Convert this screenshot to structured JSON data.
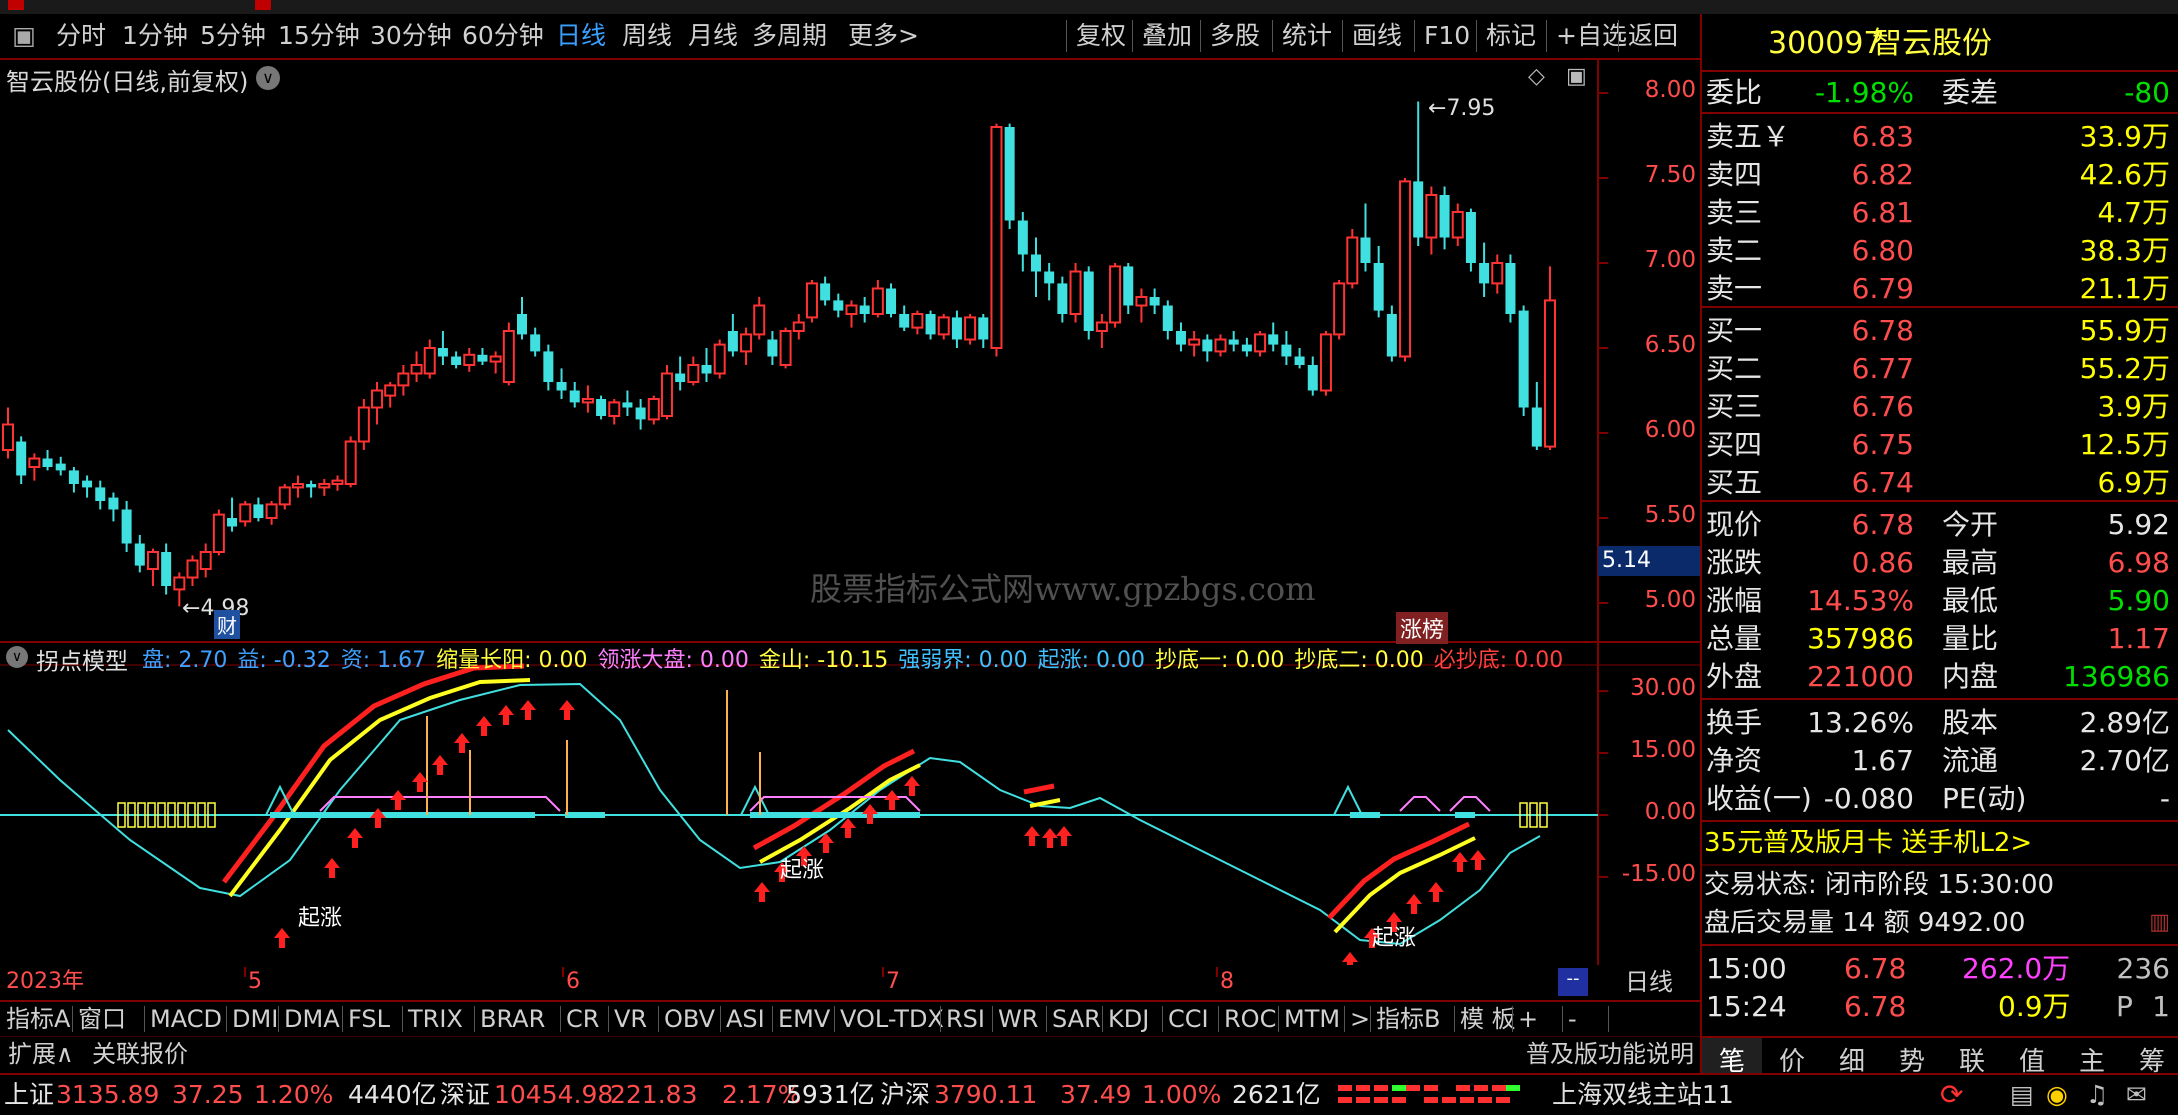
{
  "toolbar": {
    "items": [
      "分时",
      "1分钟",
      "5分钟",
      "15分钟",
      "30分钟",
      "60分钟",
      "日线",
      "周线",
      "月线",
      "多周期",
      "更多>"
    ],
    "active": "日线",
    "right_items": [
      "复权",
      "叠加",
      "多股",
      "统计",
      "画线",
      "F10",
      "标记",
      "+自选",
      "返回"
    ]
  },
  "chart": {
    "title": "智云股份(日线,前复权)",
    "price_axis": [
      "8.00",
      "7.50",
      "7.00",
      "6.50",
      "6.00",
      "5.50",
      "5.00"
    ],
    "price_marker": "5.14",
    "high_label": "7.95",
    "low_label": "4.98",
    "tag_cai": "财",
    "tag_zhangbang": "涨榜",
    "watermark": "股票指标公式网www.gpzbgs.com"
  },
  "indicator": {
    "name": "拐点模型",
    "params": [
      {
        "label": "盘: 2.70",
        "color": "#40a0ff"
      },
      {
        "label": "益: -0.32",
        "color": "#40a0ff"
      },
      {
        "label": "资: 1.67",
        "color": "#40a0ff"
      },
      {
        "label": "缩量长阳: 0.00",
        "color": "#ffff40"
      },
      {
        "label": "领涨大盘: 0.00",
        "color": "#ff80ff"
      },
      {
        "label": "金山: -10.15",
        "color": "#ffff40"
      },
      {
        "label": "强弱界: 0.00",
        "color": "#40c0ff"
      },
      {
        "label": "起涨: 0.00",
        "color": "#40c0ff"
      },
      {
        "label": "抄底一: 0.00",
        "color": "#ffff40"
      },
      {
        "label": "抄底二: 0.00",
        "color": "#ffff40"
      },
      {
        "label": "必抄底: 0.00",
        "color": "#ff4040"
      }
    ],
    "axis": [
      "30.00",
      "15.00",
      "0.00",
      "-15.00"
    ],
    "qizhang": "起涨"
  },
  "date_axis": {
    "labels": [
      "2023年",
      "5",
      "6",
      "7",
      "8"
    ],
    "period": "日线"
  },
  "tabs_row1": [
    "指标A",
    "窗口",
    "MACD",
    "DMI",
    "DMA",
    "FSL",
    "TRIX",
    "BRAR",
    "CR",
    "VR",
    "OBV",
    "ASI",
    "EMV",
    "VOL-TDX",
    "RSI",
    "WR",
    "SAR",
    "KDJ",
    "CCI",
    "ROC",
    "MTM",
    ">",
    "指标B",
    "模 板",
    "+",
    "-"
  ],
  "tabs_row2": [
    "扩展∧",
    "关联报价"
  ],
  "func_desc": "普及版功能说明",
  "quote": {
    "code": "300097",
    "name": "智云股份",
    "weibi_label": "委比",
    "weibi": "-1.98%",
    "weicha_label": "委差",
    "weicha": "-80",
    "sell": [
      [
        "卖五￥",
        "6.83",
        "33.9万"
      ],
      [
        "卖四",
        "6.82",
        "42.6万"
      ],
      [
        "卖三",
        "6.81",
        "4.7万"
      ],
      [
        "卖二",
        "6.80",
        "38.3万"
      ],
      [
        "卖一",
        "6.79",
        "21.1万"
      ]
    ],
    "buy": [
      [
        "买一",
        "6.78",
        "55.9万"
      ],
      [
        "买二",
        "6.77",
        "55.2万"
      ],
      [
        "买三",
        "6.76",
        "3.9万"
      ],
      [
        "买四",
        "6.75",
        "12.5万"
      ],
      [
        "买五",
        "6.74",
        "6.9万"
      ]
    ],
    "stats": [
      [
        "现价",
        "6.78",
        "今开",
        "5.92"
      ],
      [
        "涨跌",
        "0.86",
        "最高",
        "6.98"
      ],
      [
        "涨幅",
        "14.53%",
        "最低",
        "5.90"
      ],
      [
        "总量",
        "357986",
        "量比",
        "1.17"
      ],
      [
        "外盘",
        "221000",
        "内盘",
        "136986"
      ]
    ],
    "stats2": [
      [
        "换手",
        "13.26%",
        "股本",
        "2.89亿"
      ],
      [
        "净资",
        "1.67",
        "流通",
        "2.70亿"
      ],
      [
        "收益(一)",
        "-0.080",
        "PE(动)",
        "-"
      ]
    ],
    "promo": "35元普及版月卡 送手机L2>",
    "trade_state": "交易状态: 闭市阶段 15:30:00",
    "after_hours": "盘后交易量 14 额 9492.00",
    "ticks": [
      [
        "15:00",
        "6.78",
        "262.0万",
        "236"
      ],
      [
        "15:24",
        "6.78",
        "0.9万",
        "P",
        "1"
      ]
    ],
    "rtabs": [
      "笔",
      "价",
      "细",
      "势",
      "联",
      "值",
      "主",
      "筹"
    ]
  },
  "status": {
    "sh": {
      "label": "上证",
      "value": "3135.89",
      "chg": "37.25",
      "pct": "1.20%",
      "amt": "4440亿"
    },
    "sz": {
      "label": "深证",
      "value": "10454.98",
      "chg": "221.83",
      "pct": "2.17%",
      "amt": "5931亿"
    },
    "hs": {
      "label": "沪深",
      "value": "3790.11",
      "chg": "37.49",
      "pct": "1.00%",
      "amt": "2621亿"
    },
    "server": "上海双线主站11"
  },
  "colors": {
    "up": "#ff3333",
    "down": "#40e0e0",
    "accent_border": "#800000"
  },
  "candles": [
    [
      5.9,
      6.15,
      5.85,
      6.05
    ],
    [
      5.95,
      5.98,
      5.7,
      5.75
    ],
    [
      5.8,
      5.88,
      5.72,
      5.85
    ],
    [
      5.85,
      5.9,
      5.78,
      5.8
    ],
    [
      5.82,
      5.86,
      5.75,
      5.78
    ],
    [
      5.78,
      5.8,
      5.65,
      5.7
    ],
    [
      5.72,
      5.75,
      5.62,
      5.68
    ],
    [
      5.68,
      5.72,
      5.55,
      5.6
    ],
    [
      5.62,
      5.65,
      5.48,
      5.55
    ],
    [
      5.55,
      5.6,
      5.3,
      5.35
    ],
    [
      5.35,
      5.4,
      5.18,
      5.22
    ],
    [
      5.2,
      5.32,
      5.1,
      5.3
    ],
    [
      5.3,
      5.35,
      5.05,
      5.1
    ],
    [
      5.08,
      5.18,
      4.98,
      5.15
    ],
    [
      5.15,
      5.28,
      5.1,
      5.25
    ],
    [
      5.2,
      5.35,
      5.15,
      5.3
    ],
    [
      5.3,
      5.55,
      5.28,
      5.52
    ],
    [
      5.5,
      5.62,
      5.42,
      5.45
    ],
    [
      5.48,
      5.6,
      5.45,
      5.58
    ],
    [
      5.58,
      5.62,
      5.48,
      5.5
    ],
    [
      5.5,
      5.6,
      5.46,
      5.58
    ],
    [
      5.58,
      5.7,
      5.55,
      5.68
    ],
    [
      5.68,
      5.75,
      5.62,
      5.7
    ],
    [
      5.7,
      5.72,
      5.62,
      5.68
    ],
    [
      5.68,
      5.73,
      5.63,
      5.7
    ],
    [
      5.7,
      5.75,
      5.66,
      5.72
    ],
    [
      5.7,
      5.98,
      5.68,
      5.95
    ],
    [
      5.95,
      6.2,
      5.9,
      6.15
    ],
    [
      6.15,
      6.3,
      6.05,
      6.25
    ],
    [
      6.22,
      6.3,
      6.15,
      6.28
    ],
    [
      6.28,
      6.4,
      6.22,
      6.35
    ],
    [
      6.35,
      6.48,
      6.3,
      6.4
    ],
    [
      6.35,
      6.55,
      6.32,
      6.5
    ],
    [
      6.5,
      6.6,
      6.4,
      6.45
    ],
    [
      6.45,
      6.48,
      6.38,
      6.4
    ],
    [
      6.4,
      6.5,
      6.36,
      6.46
    ],
    [
      6.46,
      6.5,
      6.4,
      6.42
    ],
    [
      6.42,
      6.48,
      6.35,
      6.45
    ],
    [
      6.3,
      6.65,
      6.28,
      6.6
    ],
    [
      6.7,
      6.8,
      6.55,
      6.58
    ],
    [
      6.58,
      6.62,
      6.45,
      6.48
    ],
    [
      6.48,
      6.52,
      6.25,
      6.3
    ],
    [
      6.3,
      6.38,
      6.2,
      6.25
    ],
    [
      6.25,
      6.3,
      6.15,
      6.18
    ],
    [
      6.18,
      6.28,
      6.12,
      6.2
    ],
    [
      6.2,
      6.22,
      6.08,
      6.1
    ],
    [
      6.1,
      6.2,
      6.05,
      6.18
    ],
    [
      6.18,
      6.25,
      6.1,
      6.15
    ],
    [
      6.15,
      6.2,
      6.02,
      6.08
    ],
    [
      6.08,
      6.22,
      6.05,
      6.2
    ],
    [
      6.1,
      6.4,
      6.08,
      6.35
    ],
    [
      6.35,
      6.45,
      6.25,
      6.3
    ],
    [
      6.3,
      6.45,
      6.28,
      6.4
    ],
    [
      6.4,
      6.5,
      6.3,
      6.35
    ],
    [
      6.35,
      6.55,
      6.32,
      6.52
    ],
    [
      6.6,
      6.7,
      6.45,
      6.48
    ],
    [
      6.48,
      6.62,
      6.4,
      6.58
    ],
    [
      6.58,
      6.8,
      6.55,
      6.75
    ],
    [
      6.55,
      6.6,
      6.4,
      6.45
    ],
    [
      6.4,
      6.62,
      6.38,
      6.6
    ],
    [
      6.6,
      6.7,
      6.55,
      6.65
    ],
    [
      6.68,
      6.9,
      6.65,
      6.88
    ],
    [
      6.88,
      6.92,
      6.75,
      6.78
    ],
    [
      6.78,
      6.82,
      6.68,
      6.72
    ],
    [
      6.7,
      6.78,
      6.62,
      6.75
    ],
    [
      6.75,
      6.8,
      6.65,
      6.7
    ],
    [
      6.7,
      6.9,
      6.68,
      6.85
    ],
    [
      6.85,
      6.88,
      6.68,
      6.7
    ],
    [
      6.7,
      6.75,
      6.6,
      6.62
    ],
    [
      6.62,
      6.72,
      6.58,
      6.7
    ],
    [
      6.7,
      6.72,
      6.55,
      6.58
    ],
    [
      6.58,
      6.7,
      6.55,
      6.68
    ],
    [
      6.68,
      6.72,
      6.5,
      6.55
    ],
    [
      6.55,
      6.7,
      6.52,
      6.68
    ],
    [
      6.68,
      6.7,
      6.5,
      6.55
    ],
    [
      6.5,
      7.82,
      6.45,
      7.8
    ],
    [
      7.8,
      7.82,
      7.2,
      7.25
    ],
    [
      7.25,
      7.3,
      6.95,
      7.05
    ],
    [
      7.05,
      7.15,
      6.8,
      6.95
    ],
    [
      6.95,
      7.0,
      6.78,
      6.88
    ],
    [
      6.88,
      6.92,
      6.65,
      6.7
    ],
    [
      6.7,
      7.0,
      6.65,
      6.95
    ],
    [
      6.95,
      6.98,
      6.55,
      6.6
    ],
    [
      6.6,
      6.7,
      6.5,
      6.65
    ],
    [
      6.65,
      7.0,
      6.62,
      6.98
    ],
    [
      6.98,
      7.0,
      6.7,
      6.75
    ],
    [
      6.75,
      6.85,
      6.65,
      6.8
    ],
    [
      6.8,
      6.85,
      6.7,
      6.75
    ],
    [
      6.75,
      6.78,
      6.55,
      6.6
    ],
    [
      6.6,
      6.65,
      6.48,
      6.52
    ],
    [
      6.52,
      6.6,
      6.45,
      6.55
    ],
    [
      6.55,
      6.58,
      6.42,
      6.48
    ],
    [
      6.48,
      6.58,
      6.45,
      6.55
    ],
    [
      6.55,
      6.6,
      6.48,
      6.52
    ],
    [
      6.52,
      6.56,
      6.45,
      6.48
    ],
    [
      6.48,
      6.6,
      6.45,
      6.58
    ],
    [
      6.58,
      6.65,
      6.48,
      6.52
    ],
    [
      6.52,
      6.6,
      6.4,
      6.45
    ],
    [
      6.45,
      6.5,
      6.38,
      6.4
    ],
    [
      6.4,
      6.45,
      6.22,
      6.25
    ],
    [
      6.25,
      6.6,
      6.22,
      6.58
    ],
    [
      6.58,
      6.9,
      6.55,
      6.88
    ],
    [
      6.88,
      7.2,
      6.85,
      7.15
    ],
    [
      7.15,
      7.35,
      6.95,
      7.0
    ],
    [
      7.0,
      7.1,
      6.68,
      6.72
    ],
    [
      6.7,
      6.75,
      6.42,
      6.45
    ],
    [
      6.45,
      7.5,
      6.42,
      7.48
    ],
    [
      7.48,
      7.95,
      7.1,
      7.15
    ],
    [
      7.15,
      7.45,
      7.05,
      7.4
    ],
    [
      7.4,
      7.45,
      7.08,
      7.15
    ],
    [
      7.15,
      7.35,
      7.1,
      7.3
    ],
    [
      7.3,
      7.32,
      6.95,
      7.0
    ],
    [
      7.0,
      7.12,
      6.8,
      6.88
    ],
    [
      6.88,
      7.05,
      6.82,
      7.0
    ],
    [
      7.0,
      7.05,
      6.65,
      6.7
    ],
    [
      6.72,
      6.75,
      6.1,
      6.15
    ],
    [
      6.15,
      6.3,
      5.9,
      5.92
    ],
    [
      5.92,
      6.98,
      5.9,
      6.78
    ]
  ]
}
